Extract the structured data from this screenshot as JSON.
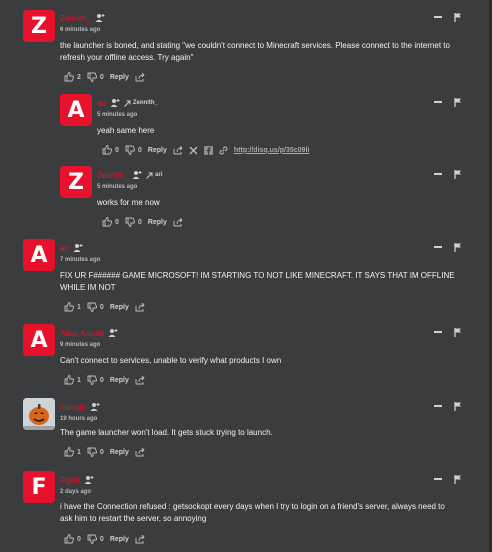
{
  "comments": [
    {
      "initial": "Z",
      "author": "Zennith_",
      "time": "6 minutes ago",
      "text": "the launcher is boned, and stating \"we couldn't connect to Minecraft services. Please connect to the internet to refresh your offline access. Try again\"",
      "upvotes": "2",
      "downvotes": "0",
      "reply": "Reply"
    },
    {
      "initial": "A",
      "author": "ari",
      "reply_to": "Zennith_",
      "time": "5 minutes ago",
      "text": "yeah same here",
      "upvotes": "0",
      "downvotes": "0",
      "reply": "Reply",
      "share_link": "http://disq.us/p/35c09li"
    },
    {
      "initial": "Z",
      "author": "Zennith_",
      "reply_to": "ari",
      "time": "5 minutes ago",
      "text": "works for me now",
      "upvotes": "0",
      "downvotes": "0",
      "reply": "Reply"
    },
    {
      "initial": "A",
      "author": "ari",
      "time": "7 minutes ago",
      "text": "FIX UR F###### GAME MICROSOFT! IM STARTING TO NOT LIKE MINECRAFT. IT SAYS THAT IM OFFLINE WHILE IM NOT",
      "upvotes": "1",
      "downvotes": "0",
      "reply": "Reply"
    },
    {
      "initial": "A",
      "author": "Abdo Kanan",
      "time": "9 minutes ago",
      "text": "Can't connect to services, unable to verify what products I own",
      "upvotes": "1",
      "downvotes": "0",
      "reply": "Reply"
    },
    {
      "initial": "",
      "author": "haleigh",
      "time": "19 hours ago",
      "text": "The game launcher won't load. It gets stuck trying to launch.",
      "upvotes": "1",
      "downvotes": "0",
      "reply": "Reply"
    },
    {
      "initial": "F",
      "author": "Fightr",
      "time": "2 days ago",
      "text": "i have the Connection refused : getsockopt every days when I try to login on a friend's server, always need to ask him to restart the server, so annoying",
      "upvotes": "0",
      "downvotes": "0",
      "reply": "Reply"
    }
  ],
  "colors": {
    "accent": "#e8112b",
    "background": "#3b3c3e"
  },
  "icons": [
    "thumbs-up-icon",
    "thumbs-down-icon",
    "share-icon",
    "user-follow-icon",
    "reply-arrow-icon",
    "x-icon",
    "facebook-icon",
    "link-icon",
    "minus-icon",
    "flag-icon"
  ]
}
